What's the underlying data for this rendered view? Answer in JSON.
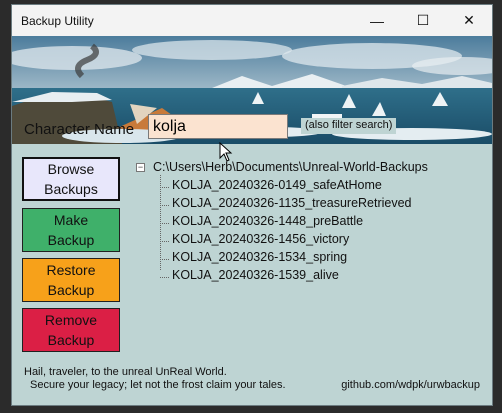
{
  "window": {
    "title": "Backup Utility",
    "controls": {
      "minimize": "—",
      "maximize": "☐",
      "close": "✕"
    }
  },
  "character": {
    "label": "Character Name",
    "value": "kolja",
    "hint": "(also filter search)"
  },
  "buttons": {
    "browse": "Browse\nBackups",
    "make": "Make\nBackup",
    "restore": "Restore\nBackup",
    "remove": "Remove\nBackup"
  },
  "tree": {
    "expander": "−",
    "root": "C:\\Users\\Herb\\Documents\\Unreal-World-Backups",
    "children": [
      "KOLJA_20240326-0149_safeAtHome",
      "KOLJA_20240326-1135_treasureRetrieved",
      "KOLJA_20240326-1448_preBattle",
      "KOLJA_20240326-1456_victory",
      "KOLJA_20240326-1534_spring",
      "KOLJA_20240326-1539_alive"
    ]
  },
  "footer": {
    "line1": "Hail, traveler, to the unreal UnReal World.",
    "line2": "Secure your legacy; let not the frost claim your tales.",
    "github": "github.com/wdpk/urwbackup"
  },
  "colors": {
    "background": "#bed4d3",
    "input_bg": "#fbe3d0",
    "browse": "#e8e7fb",
    "make": "#3fb06a",
    "restore": "#f7a11a",
    "remove": "#db1f45"
  }
}
